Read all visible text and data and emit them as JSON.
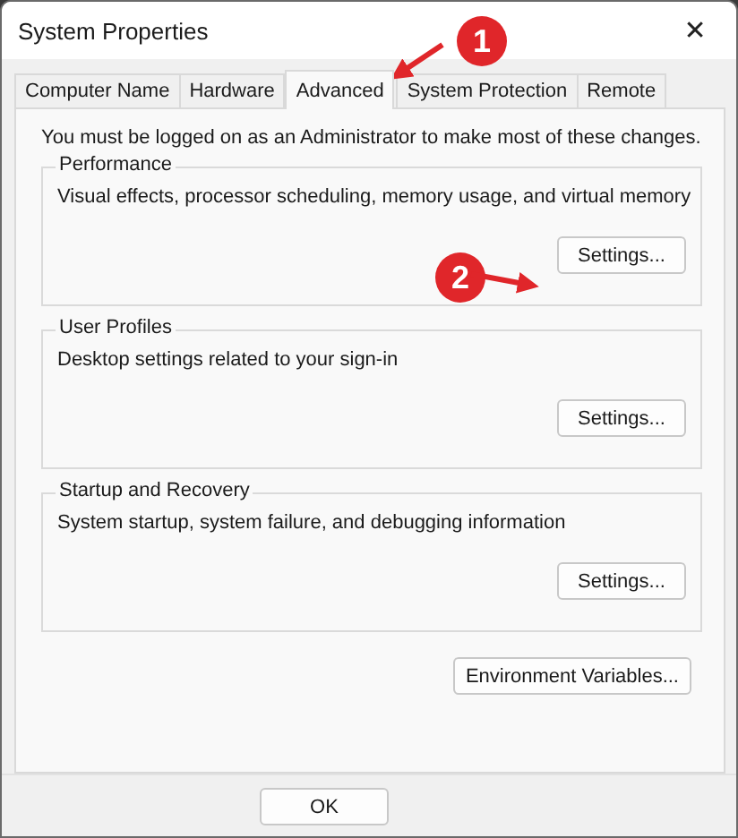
{
  "window": {
    "title": "System Properties",
    "close": "✕"
  },
  "tabs": [
    {
      "label": "Computer Name",
      "selected": false
    },
    {
      "label": "Hardware",
      "selected": false
    },
    {
      "label": "Advanced",
      "selected": true
    },
    {
      "label": "System Protection",
      "selected": false
    },
    {
      "label": "Remote",
      "selected": false
    }
  ],
  "notice": "You must be logged on as an Administrator to make most of these changes.",
  "groups": [
    {
      "title": "Performance",
      "description": "Visual effects, processor scheduling, memory usage, and virtual memory",
      "button": "Settings..."
    },
    {
      "title": "User Profiles",
      "description": "Desktop settings related to your sign-in",
      "button": "Settings..."
    },
    {
      "title": "Startup and Recovery",
      "description": "System startup, system failure, and debugging information",
      "button": "Settings..."
    }
  ],
  "extra_button": "Environment Variables...",
  "footer_buttons": [
    "OK"
  ],
  "annotations": [
    {
      "label": "1"
    },
    {
      "label": "2"
    }
  ]
}
